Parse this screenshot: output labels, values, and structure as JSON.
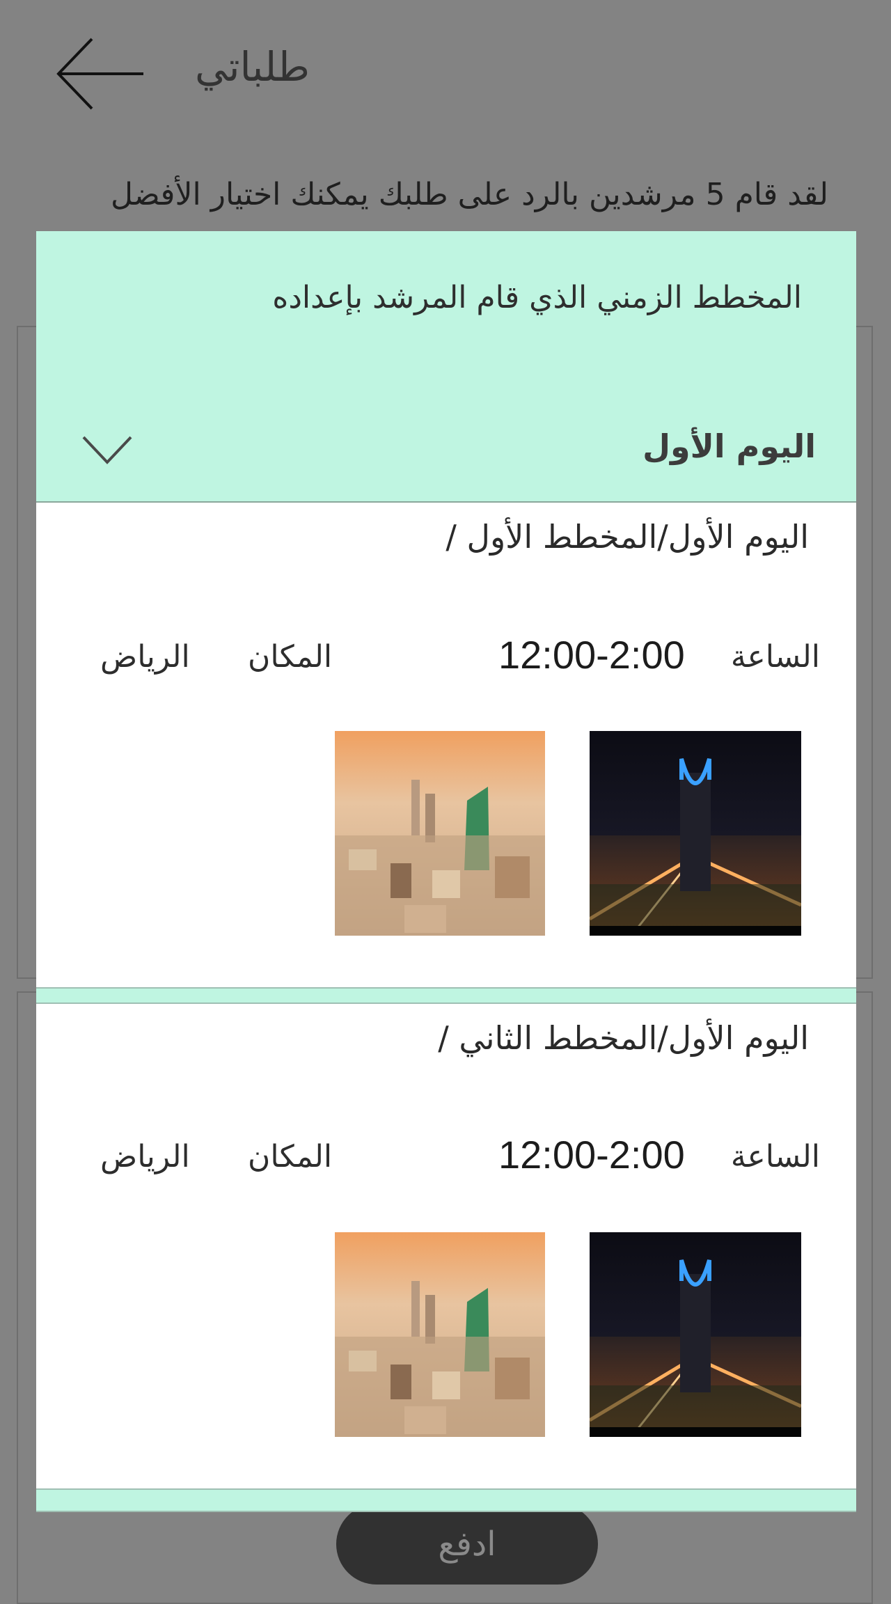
{
  "header": {
    "title": "طلباتي",
    "back_icon": "arrow-left-icon"
  },
  "subtitle": "لقد قام 5 مرشدين بالرد على طلبك يمكنك اختيار الأفضل",
  "pay_button": "ادفع",
  "modal": {
    "title": "المخطط الزمني الذي قام المرشد بإعداده",
    "day": "اليوم الأول",
    "chevron_icon": "chevron-down-icon",
    "plans": [
      {
        "title": "اليوم الأول/المخطط الأول /",
        "time_label": "الساعة",
        "time_value": "12:00-2:00",
        "place_label": "المكان",
        "place_value": "الرياض",
        "photos": [
          "kingdom-tower-night-photo",
          "riyadh-skyline-sunset-photo"
        ]
      },
      {
        "title": "اليوم الأول/المخطط الثاني /",
        "time_label": "الساعة",
        "time_value": "12:00-2:00",
        "place_label": "المكان",
        "place_value": "الرياض",
        "photos": [
          "kingdom-tower-night-photo",
          "riyadh-skyline-sunset-photo"
        ]
      }
    ]
  },
  "colors": {
    "overlay": "#838383",
    "mint": "#bff5e1",
    "pay_button": "#313131"
  }
}
